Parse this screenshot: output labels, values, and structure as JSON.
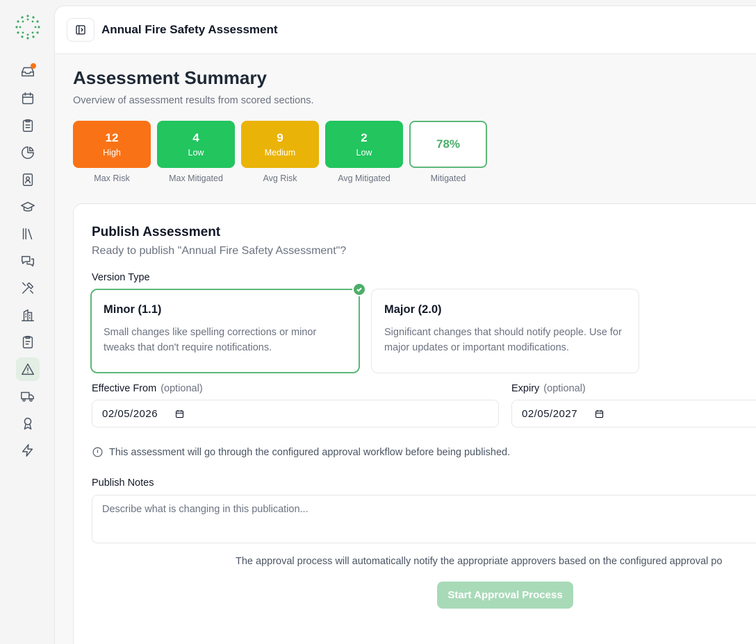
{
  "header": {
    "title": "Annual Fire Safety Assessment"
  },
  "summary": {
    "title": "Assessment Summary",
    "subtitle": "Overview of assessment results from scored sections.",
    "stats": [
      {
        "value": "12",
        "level": "High",
        "caption": "Max Risk",
        "color": "#f97316"
      },
      {
        "value": "4",
        "level": "Low",
        "caption": "Max Mitigated",
        "color": "#22c55e"
      },
      {
        "value": "9",
        "level": "Medium",
        "caption": "Avg Risk",
        "color": "#eab308"
      },
      {
        "value": "2",
        "level": "Low",
        "caption": "Avg Mitigated",
        "color": "#22c55e"
      },
      {
        "value": "78%",
        "caption": "Mitigated",
        "color": "#4cae6a"
      }
    ]
  },
  "publish": {
    "title": "Publish Assessment",
    "subtitle": "Ready to publish \"Annual Fire Safety Assessment\"?",
    "version_label": "Version Type",
    "versions": [
      {
        "title": "Minor (1.1)",
        "desc": "Small changes like spelling corrections or minor tweaks that don't require notifications.",
        "selected": true
      },
      {
        "title": "Major (2.0)",
        "desc": "Significant changes that should notify people. Use for major updates or important modifications.",
        "selected": false
      }
    ],
    "effective_label": "Effective From",
    "expiry_label": "Expiry",
    "optional": "(optional)",
    "effective_value": "02/05/2026",
    "expiry_value": "02/05/2027",
    "info": "This assessment will go through the configured approval workflow before being published.",
    "notes_label": "Publish Notes",
    "notes_placeholder": "Describe what is changing in this publication...",
    "approval_note": "The approval process will automatically notify the appropriate approvers based on the configured approval po",
    "start_button": "Start Approval Process"
  },
  "nav": [
    "inbox-icon",
    "calendar-icon",
    "checklist-icon",
    "pie-chart-icon",
    "contact-book-icon",
    "graduation-cap-icon",
    "library-icon",
    "messages-icon",
    "tools-icon",
    "building-icon",
    "clipboard-icon",
    "alert-triangle-icon",
    "truck-icon",
    "award-icon",
    "zap-icon"
  ],
  "colors": {
    "accent": "#4cae6a",
    "notification": "#f97316"
  }
}
